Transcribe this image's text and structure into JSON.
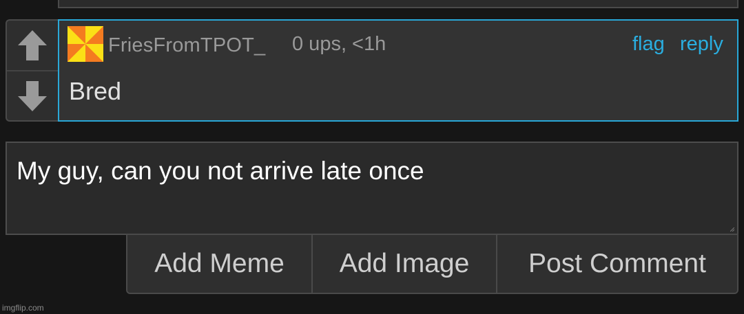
{
  "comment": {
    "username": "FriesFromTPOT_",
    "meta": "0 ups, <1h",
    "flag_label": "flag",
    "reply_label": "reply",
    "text": "Bred"
  },
  "reply_box": {
    "value": "My guy, can you not arrive late once"
  },
  "actions": {
    "add_meme": "Add Meme",
    "add_image": "Add Image",
    "post_comment": "Post Comment"
  },
  "watermark": "imgflip.com",
  "colors": {
    "accent": "#29a8d8",
    "background": "#161616",
    "panel": "#333333"
  },
  "icons": {
    "upvote": "up-arrow-icon",
    "downvote": "down-arrow-icon",
    "avatar": "pinwheel-avatar"
  }
}
